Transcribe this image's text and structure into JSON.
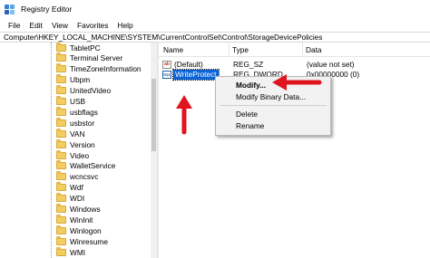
{
  "window": {
    "title": "Registry Editor"
  },
  "menu": [
    "File",
    "Edit",
    "View",
    "Favorites",
    "Help"
  ],
  "address": "Computer\\HKEY_LOCAL_MACHINE\\SYSTEM\\CurrentControlSet\\Control\\StorageDevicePolicies",
  "tree": {
    "items": [
      "TabletPC",
      "Terminal Server",
      "TimeZoneInformation",
      "Ubpm",
      "UnitedVideo",
      "USB",
      "usbflags",
      "usbstor",
      "VAN",
      "Version",
      "Video",
      "WalletService",
      "wcncsvc",
      "Wdf",
      "WDI",
      "Windows",
      "WinInit",
      "Winlogon",
      "Winresume",
      "WMI"
    ]
  },
  "list": {
    "headers": {
      "name": "Name",
      "type": "Type",
      "data": "Data"
    },
    "rows": [
      {
        "name": "(Default)",
        "type": "REG_SZ",
        "data": "(value not set)",
        "icon": "string-value-icon"
      },
      {
        "name": "WriteProtect",
        "type": "REG_DWORD",
        "data": "0x00000000 (0)",
        "icon": "binary-value-icon"
      }
    ]
  },
  "context_menu": {
    "items": [
      "Modify...",
      "Modify Binary Data...",
      "Delete",
      "Rename"
    ]
  },
  "colors": {
    "selection": "#0a64d6",
    "annotation_arrow": "#e0141e",
    "folder": "#f3cd60"
  }
}
